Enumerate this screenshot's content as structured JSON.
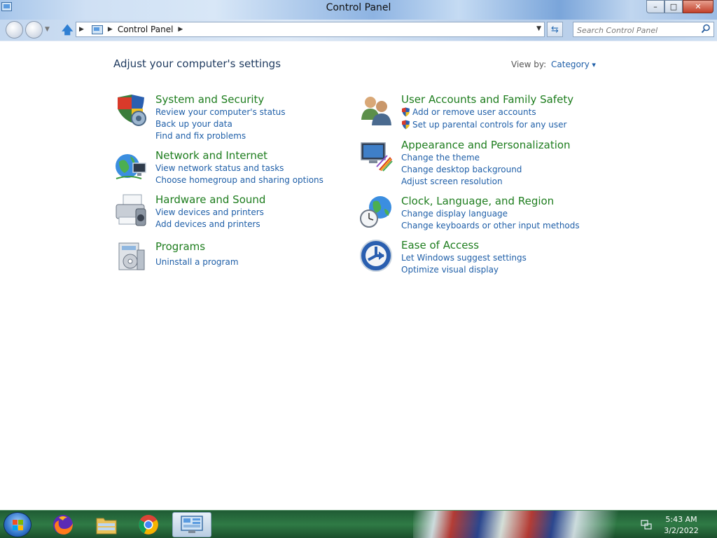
{
  "window": {
    "title": "Control Panel",
    "controls": {
      "minimize": "–",
      "maximize": "□",
      "close": "✕"
    }
  },
  "navigation": {
    "breadcrumb": [
      "Control Panel"
    ],
    "search_placeholder": "Search Control Panel"
  },
  "main": {
    "heading": "Adjust your computer's settings",
    "view_by": {
      "label": "View by:",
      "value": "Category"
    },
    "categories": [
      {
        "icon": "shield-icon",
        "title": "System and Security",
        "links": [
          "Review your computer's status",
          "Back up your data",
          "Find and fix problems"
        ]
      },
      {
        "icon": "network-icon",
        "title": "Network and Internet",
        "links": [
          "View network status and tasks",
          "Choose homegroup and sharing options"
        ]
      },
      {
        "icon": "printer-icon",
        "title": "Hardware and Sound",
        "links": [
          "View devices and printers",
          "Add devices and printers"
        ]
      },
      {
        "icon": "programs-icon",
        "title": "Programs",
        "links": [
          "Uninstall a program"
        ]
      },
      {
        "icon": "users-icon",
        "title": "User Accounts and Family Safety",
        "links": [
          "Add or remove user accounts",
          "Set up parental controls for any user"
        ]
      },
      {
        "icon": "appearance-icon",
        "title": "Appearance and Personalization",
        "links": [
          "Change the theme",
          "Change desktop background",
          "Adjust screen resolution"
        ]
      },
      {
        "icon": "clock-globe-icon",
        "title": "Clock, Language, and Region",
        "links": [
          "Change display language",
          "Change keyboards or other input methods"
        ]
      },
      {
        "icon": "accessibility-icon",
        "title": "Ease of Access",
        "links": [
          "Let Windows suggest settings",
          "Optimize visual display"
        ]
      }
    ]
  },
  "taskbar": {
    "items": [
      "firefox-icon",
      "file-explorer-icon",
      "chrome-icon",
      "control-panel-icon"
    ],
    "clock": {
      "time": "5:43 AM",
      "date": "3/2/2022"
    }
  },
  "colors": {
    "category_title": "#1e7d1e",
    "link": "#1f5fa8",
    "heading": "#1e3a5f",
    "taskbar": "#2f7a45"
  }
}
